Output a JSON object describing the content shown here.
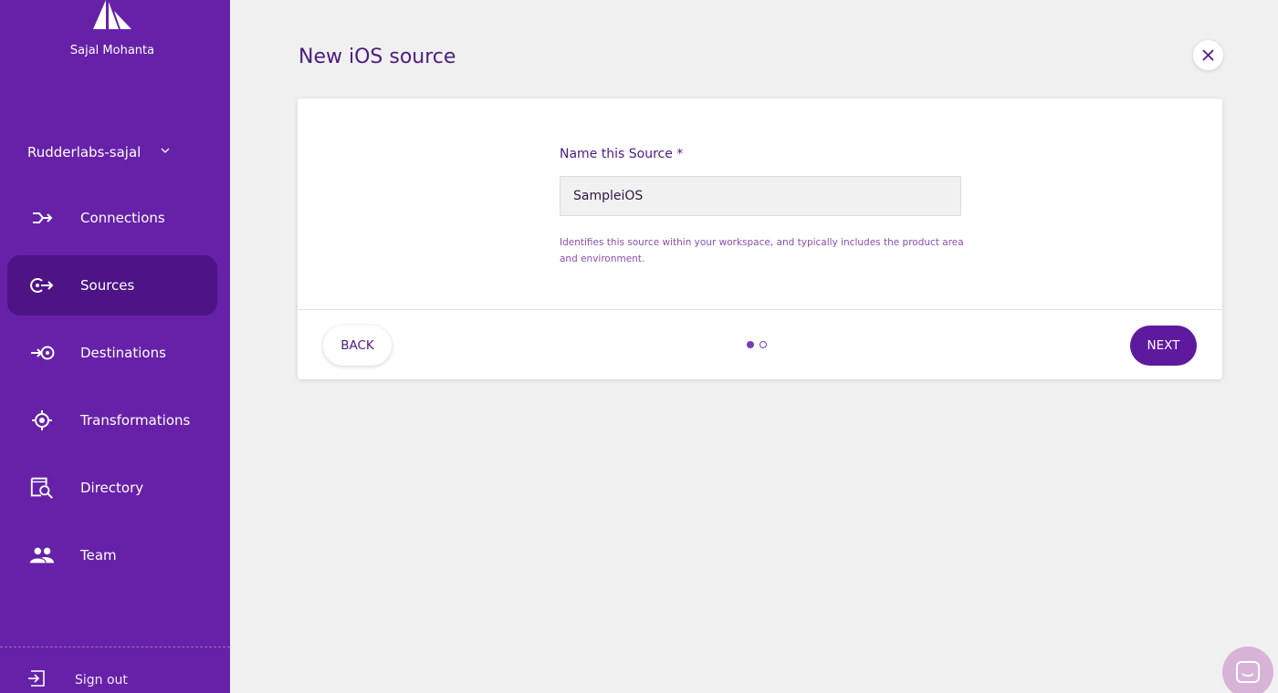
{
  "sidebar": {
    "user_name": "Sajal Mohanta",
    "workspace": "Rudderlabs-sajal",
    "items": [
      {
        "label": "Connections",
        "icon": "connections-icon",
        "active": false
      },
      {
        "label": "Sources",
        "icon": "sources-icon",
        "active": true
      },
      {
        "label": "Destinations",
        "icon": "destinations-icon",
        "active": false
      },
      {
        "label": "Transformations",
        "icon": "transformations-icon",
        "active": false
      },
      {
        "label": "Directory",
        "icon": "directory-icon",
        "active": false
      },
      {
        "label": "Team",
        "icon": "team-icon",
        "active": false
      }
    ],
    "sign_out": "Sign out"
  },
  "main": {
    "title": "New iOS source",
    "form": {
      "label": "Name this Source *",
      "value": "SampleiOS",
      "help": "Identifies this source within your workspace, and typically includes the product area and environment."
    },
    "back_label": "BACK",
    "next_label": "NEXT",
    "steps": {
      "current": 1,
      "total": 2
    }
  },
  "colors": {
    "sidebar": "#6621a8",
    "sidebar_active": "#4e1486",
    "accent": "#5e1a9f",
    "title_text": "#4b1c80",
    "background": "#f1f0f1"
  }
}
